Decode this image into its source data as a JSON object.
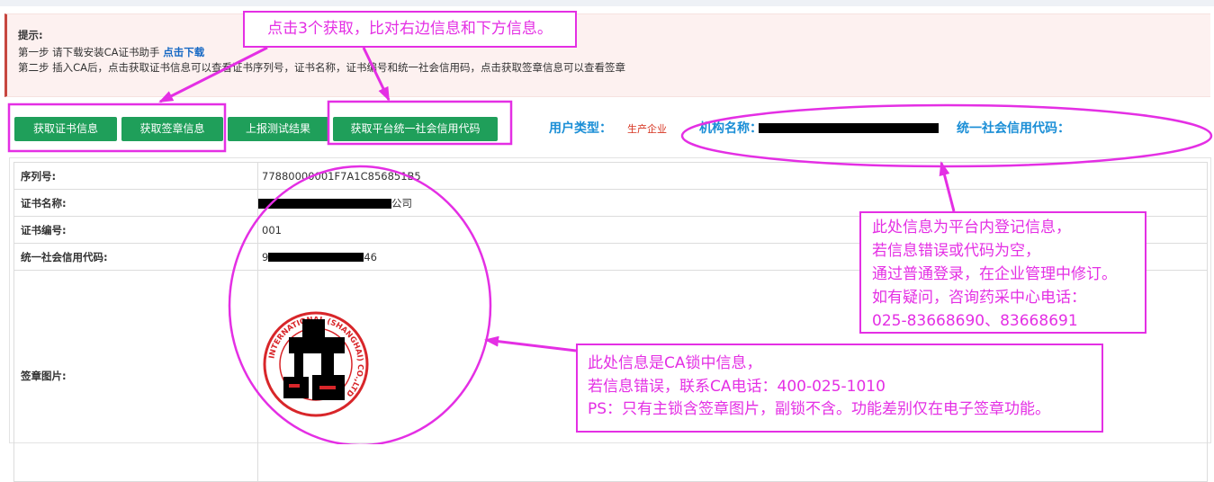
{
  "notice": {
    "title": "提示:",
    "step1_text": "第一步 请下载安装CA证书助手 ",
    "step1_link": "点击下载",
    "step2": "第二步 插入CA后，点击获取证书信息可以查看证书序列号，证书名称，证书编号和统一社会信用码，点击获取签章信息可以查看签章"
  },
  "toolbar": {
    "get_cert_info": "获取证书信息",
    "get_seal_info": "获取签章信息",
    "report_test": "上报测试结果",
    "get_platform_code": "获取平台统一社会信用代码"
  },
  "header": {
    "user_type_label": "用户类型：",
    "user_type_value": "生产企业",
    "org_name_label": "机构名称：",
    "credit_code_label": "统一社会信用代码："
  },
  "table": {
    "rows": [
      {
        "label": "序列号:",
        "value": "77880000001F7A1C856851B5"
      },
      {
        "label": "证书名称:",
        "value_suffix": "公司"
      },
      {
        "label": "证书编号:",
        "value": "001"
      },
      {
        "label": "统一社会信用代码:",
        "value_prefix": "9",
        "value_suffix": "46"
      },
      {
        "label": "签章图片:"
      }
    ]
  },
  "seal": {
    "text": "INTERNATIONAL (SHANGHAI) CO.,LTD"
  },
  "annotations": {
    "top": "点击3个获取，比对右边信息和下方信息。",
    "platform_info": [
      "此处信息为平台内登记信息，",
      "若信息错误或代码为空，",
      "通过普通登录，在企业管理中修订。",
      "如有疑问，咨询药采中心电话：",
      "025-83668690、83668691"
    ],
    "ca_info": [
      "此处信息是CA锁中信息，",
      "若信息错误，联系CA电话：400-025-1010",
      "PS：只有主锁含签章图片，副锁不含。功能差别仅在电子签章功能。"
    ]
  },
  "colors": {
    "button_green": "#1f9f5a",
    "label_blue": "#1a8ed6",
    "link_blue": "#1769c4",
    "user_type_red": "#d6331f",
    "annotation_magenta": "#e42fe4",
    "seal_red": "#d8262a",
    "notice_bg": "#fdf1f0"
  }
}
